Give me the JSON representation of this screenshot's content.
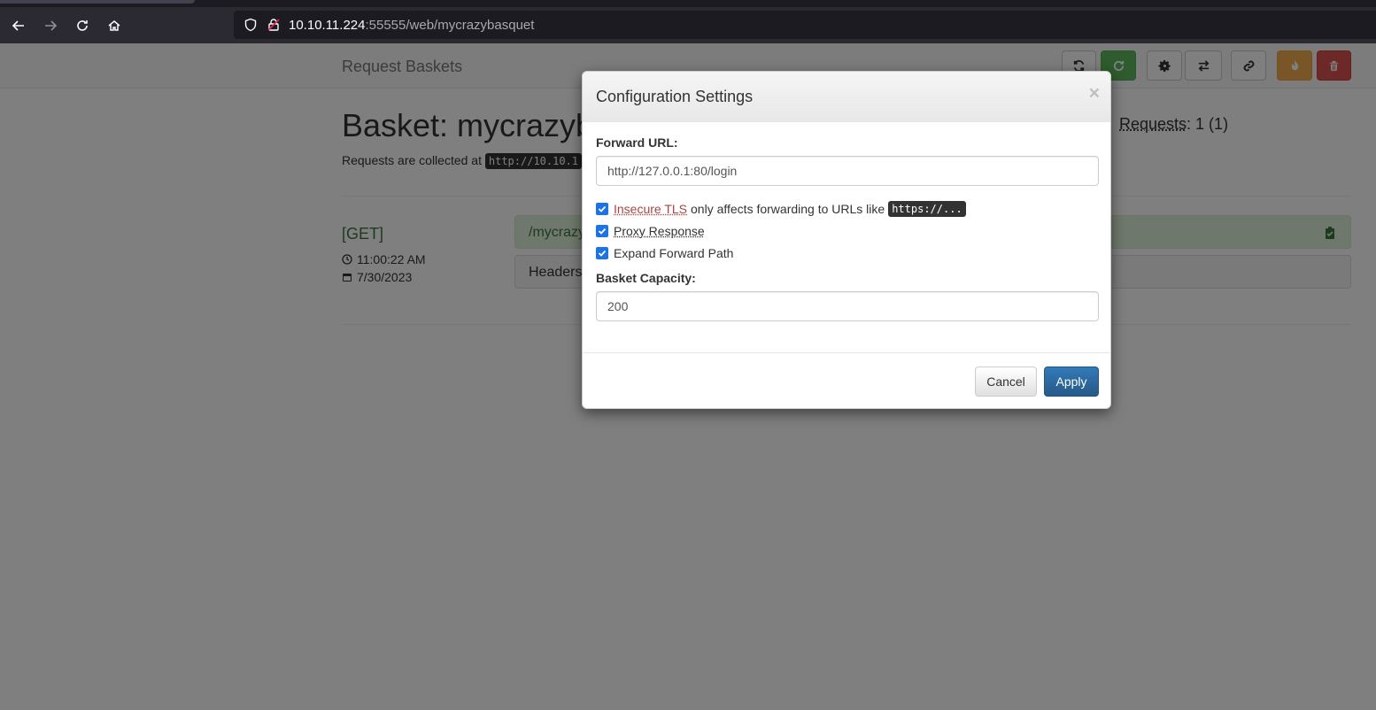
{
  "browser": {
    "url_host": "10.10.11.224",
    "url_rest": ":55555/web/mycrazybasquet",
    "icons": [
      "back-arrow-icon",
      "forward-arrow-icon",
      "reload-icon",
      "home-icon",
      "shield-icon",
      "insecure-lock-icon"
    ]
  },
  "app": {
    "brand": "Request Baskets",
    "toolbar_icons": [
      "refresh-icon",
      "auto-refresh-icon",
      "gear-icon",
      "exchange-icon",
      "link-icon",
      "fire-icon",
      "trash-icon"
    ],
    "colors": {
      "green": "#5cb85c",
      "orange": "#f0ad4e",
      "red": "#d9534f",
      "primary": "#337ab7"
    }
  },
  "basket": {
    "title": "Basket: mycrazyb",
    "requests_label": "Requests",
    "requests_value": ": 1 (1)",
    "collected_text": "Requests are collected at ",
    "collected_url": "http://10.10.1"
  },
  "request": {
    "method": "[GET]",
    "time": "11:00:22 AM",
    "date": "7/30/2023",
    "path": "/mycrazy",
    "headers_label": "Headers"
  },
  "modal": {
    "title": "Configuration Settings",
    "close": "×",
    "forward_url_label": "Forward URL:",
    "forward_url_value": "http://127.0.0.1:80/login",
    "insecure_tls_link": "Insecure TLS",
    "insecure_tls_text": "only affects forwarding to URLs like",
    "insecure_tls_code": "https://...",
    "proxy_response_label": "Proxy Response",
    "expand_path_label": "Expand Forward Path",
    "capacity_label": "Basket Capacity:",
    "capacity_value": "200",
    "cancel_label": "Cancel",
    "apply_label": "Apply"
  }
}
